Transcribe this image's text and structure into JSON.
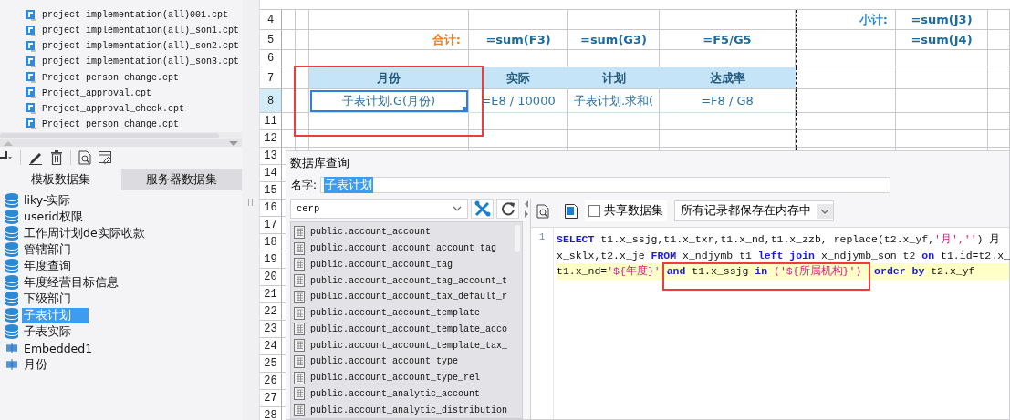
{
  "file_tree": {
    "items": [
      "project implementation(all)001.cpt",
      "project implementation(all)_son1.cpt",
      "project implementation(all)_son2.cpt",
      "project implementation(all)_son3.cpt",
      "Project person change.cpt",
      "Project_approval.cpt",
      "Project_approval_check.cpt",
      "Project person change.cpt"
    ]
  },
  "dataset_panel": {
    "tabs": [
      {
        "label": "模板数据集",
        "selected": true
      },
      {
        "label": "服务器数据集",
        "selected": false
      }
    ],
    "datasets": [
      {
        "name": "liky-实际",
        "kind": "database",
        "selected": false
      },
      {
        "name": "userid权限",
        "kind": "database",
        "selected": false
      },
      {
        "name": "工作周计划de实际收款",
        "kind": "database",
        "selected": false
      },
      {
        "name": "管辖部门",
        "kind": "database",
        "selected": false
      },
      {
        "name": "年度查询",
        "kind": "database",
        "selected": false
      },
      {
        "name": "年度经营目标信息",
        "kind": "database",
        "selected": false
      },
      {
        "name": "下级部门",
        "kind": "database",
        "selected": false
      },
      {
        "name": "子表计划",
        "kind": "database",
        "selected": true
      },
      {
        "name": "子表实际",
        "kind": "database",
        "selected": false
      },
      {
        "name": "Embedded1",
        "kind": "embedded",
        "selected": false
      },
      {
        "name": "月份",
        "kind": "embedded",
        "selected": false
      }
    ]
  },
  "sheet": {
    "rows": [
      {
        "number": "4",
        "selected": false,
        "cells": [
          {
            "selected": false
          },
          {
            "selected": false
          },
          {
            "selected": false
          },
          {
            "selected": false
          },
          {
            "selected": false
          },
          {
            "selected": false
          },
          {
            "text": "小计:",
            "kind": "subtotal-label",
            "selected": false
          },
          {
            "text": "=sum(J3)",
            "kind": "formula",
            "selected": false
          },
          {
            "selected": false
          }
        ]
      },
      {
        "number": "5",
        "selected": false,
        "cells": [
          {
            "selected": false
          },
          {
            "selected": false
          },
          {
            "text": "合计:",
            "kind": "total-label",
            "selected": false
          },
          {
            "text": "=sum(F3)",
            "kind": "formula",
            "selected": false
          },
          {
            "text": "=sum(G3)",
            "kind": "formula",
            "selected": false
          },
          {
            "text": "=F5/G5",
            "kind": "formula",
            "selected": false
          },
          {
            "selected": false
          },
          {
            "text": "=sum(J4)",
            "kind": "formula",
            "selected": false
          },
          {
            "selected": false
          }
        ]
      },
      {
        "number": "6",
        "selected": false
      },
      {
        "number": "7",
        "selected": false,
        "cells": [
          {
            "selected": false
          },
          {
            "selected": false
          },
          {
            "text": "月份",
            "kind": "column-header",
            "selected": false
          },
          {
            "text": "实际",
            "kind": "column-header",
            "selected": false
          },
          {
            "text": "计划",
            "kind": "column-header",
            "selected": false
          },
          {
            "text": "达成率",
            "kind": "column-header",
            "selected": false
          },
          {
            "selected": false
          },
          {
            "selected": false
          },
          {
            "selected": false
          }
        ]
      },
      {
        "number": "8",
        "selected": true,
        "cells": [
          {
            "selected": false
          },
          {
            "selected": false
          },
          {
            "text": "子表计划.G(月份)",
            "kind": "expression",
            "selected": true
          },
          {
            "text": "=E8 / 10000",
            "kind": "expression",
            "selected": false
          },
          {
            "text": "子表计划.求和(",
            "kind": "expression",
            "selected": false
          },
          {
            "text": "=F8 / G8",
            "kind": "expression",
            "selected": false
          },
          {
            "selected": false
          },
          {
            "selected": false
          },
          {
            "selected": false
          }
        ]
      },
      {
        "number": "11",
        "selected": false
      },
      {
        "number": "12",
        "selected": false
      },
      {
        "number": "13",
        "selected": false
      },
      {
        "number": "14",
        "selected": false
      },
      {
        "number": "15",
        "selected": false
      },
      {
        "number": "16",
        "selected": false
      },
      {
        "number": "17",
        "selected": false
      },
      {
        "number": "18",
        "selected": false
      },
      {
        "number": "19",
        "selected": false
      },
      {
        "number": "20",
        "selected": false
      },
      {
        "number": "21",
        "selected": false
      },
      {
        "number": "22",
        "selected": false
      },
      {
        "number": "23",
        "selected": false
      },
      {
        "number": "24",
        "selected": false
      },
      {
        "number": "25",
        "selected": false
      },
      {
        "number": "26",
        "selected": false
      },
      {
        "number": "27",
        "selected": false
      },
      {
        "number": "28",
        "selected": false
      }
    ]
  },
  "query_dialog": {
    "title": "数据库查询",
    "name_label": "名字:",
    "name_value": "子表计划",
    "connection": "cerp",
    "tables": [
      "public.account_account",
      "public.account_account_account_tag",
      "public.account_account_tag",
      "public.account_account_tag_account_t",
      "public.account_account_tax_default_r",
      "public.account_account_template",
      "public.account_account_template_acco",
      "public.account_account_template_tax_",
      "public.account_account_type",
      "public.account_account_type_rel",
      "public.account_analytic_account",
      "public.account_analytic_distribution"
    ],
    "shared_dataset": {
      "label": "共享数据集",
      "checked": false
    },
    "storage_mode": "所有记录都保存在内存中",
    "sql": {
      "line_number": "1",
      "rows": [
        {
          "highlighted": false,
          "tokens": [
            {
              "text": "SELECT",
              "kind": "keyword"
            },
            {
              "text": " t1.x_ssjg,t1.x_txr,t1.x_nd,t1.x_zzb, replace(t2.x_yf,",
              "kind": "plain"
            },
            {
              "text": "'月',''",
              "kind": "string"
            },
            {
              "text": ") 月",
              "kind": "plain"
            }
          ]
        },
        {
          "highlighted": false,
          "tokens": [
            {
              "text": "x_sklx,t2.x_je ",
              "kind": "plain"
            },
            {
              "text": "FROM",
              "kind": "keyword"
            },
            {
              "text": " x_ndjymb t1 ",
              "kind": "plain"
            },
            {
              "text": "left join",
              "kind": "keyword"
            },
            {
              "text": " x_ndjymb_son t2 ",
              "kind": "plain"
            },
            {
              "text": "on",
              "kind": "keyword"
            },
            {
              "text": " t1.id=t2.x_",
              "kind": "plain"
            }
          ]
        },
        {
          "highlighted": true,
          "tokens": [
            {
              "text": "t1.x_nd=",
              "kind": "plain"
            },
            {
              "text": "'${年度}'",
              "kind": "string"
            },
            {
              "text": " and",
              "kind": "keyword"
            },
            {
              "text": " t1.x_ssjg ",
              "kind": "plain"
            },
            {
              "text": "in ",
              "kind": "keyword"
            },
            {
              "text": "('${所属机构}')",
              "kind": "string"
            },
            {
              "text": "  order by",
              "kind": "keyword"
            },
            {
              "text": " t2.x_yf",
              "kind": "plain"
            }
          ]
        }
      ]
    }
  }
}
